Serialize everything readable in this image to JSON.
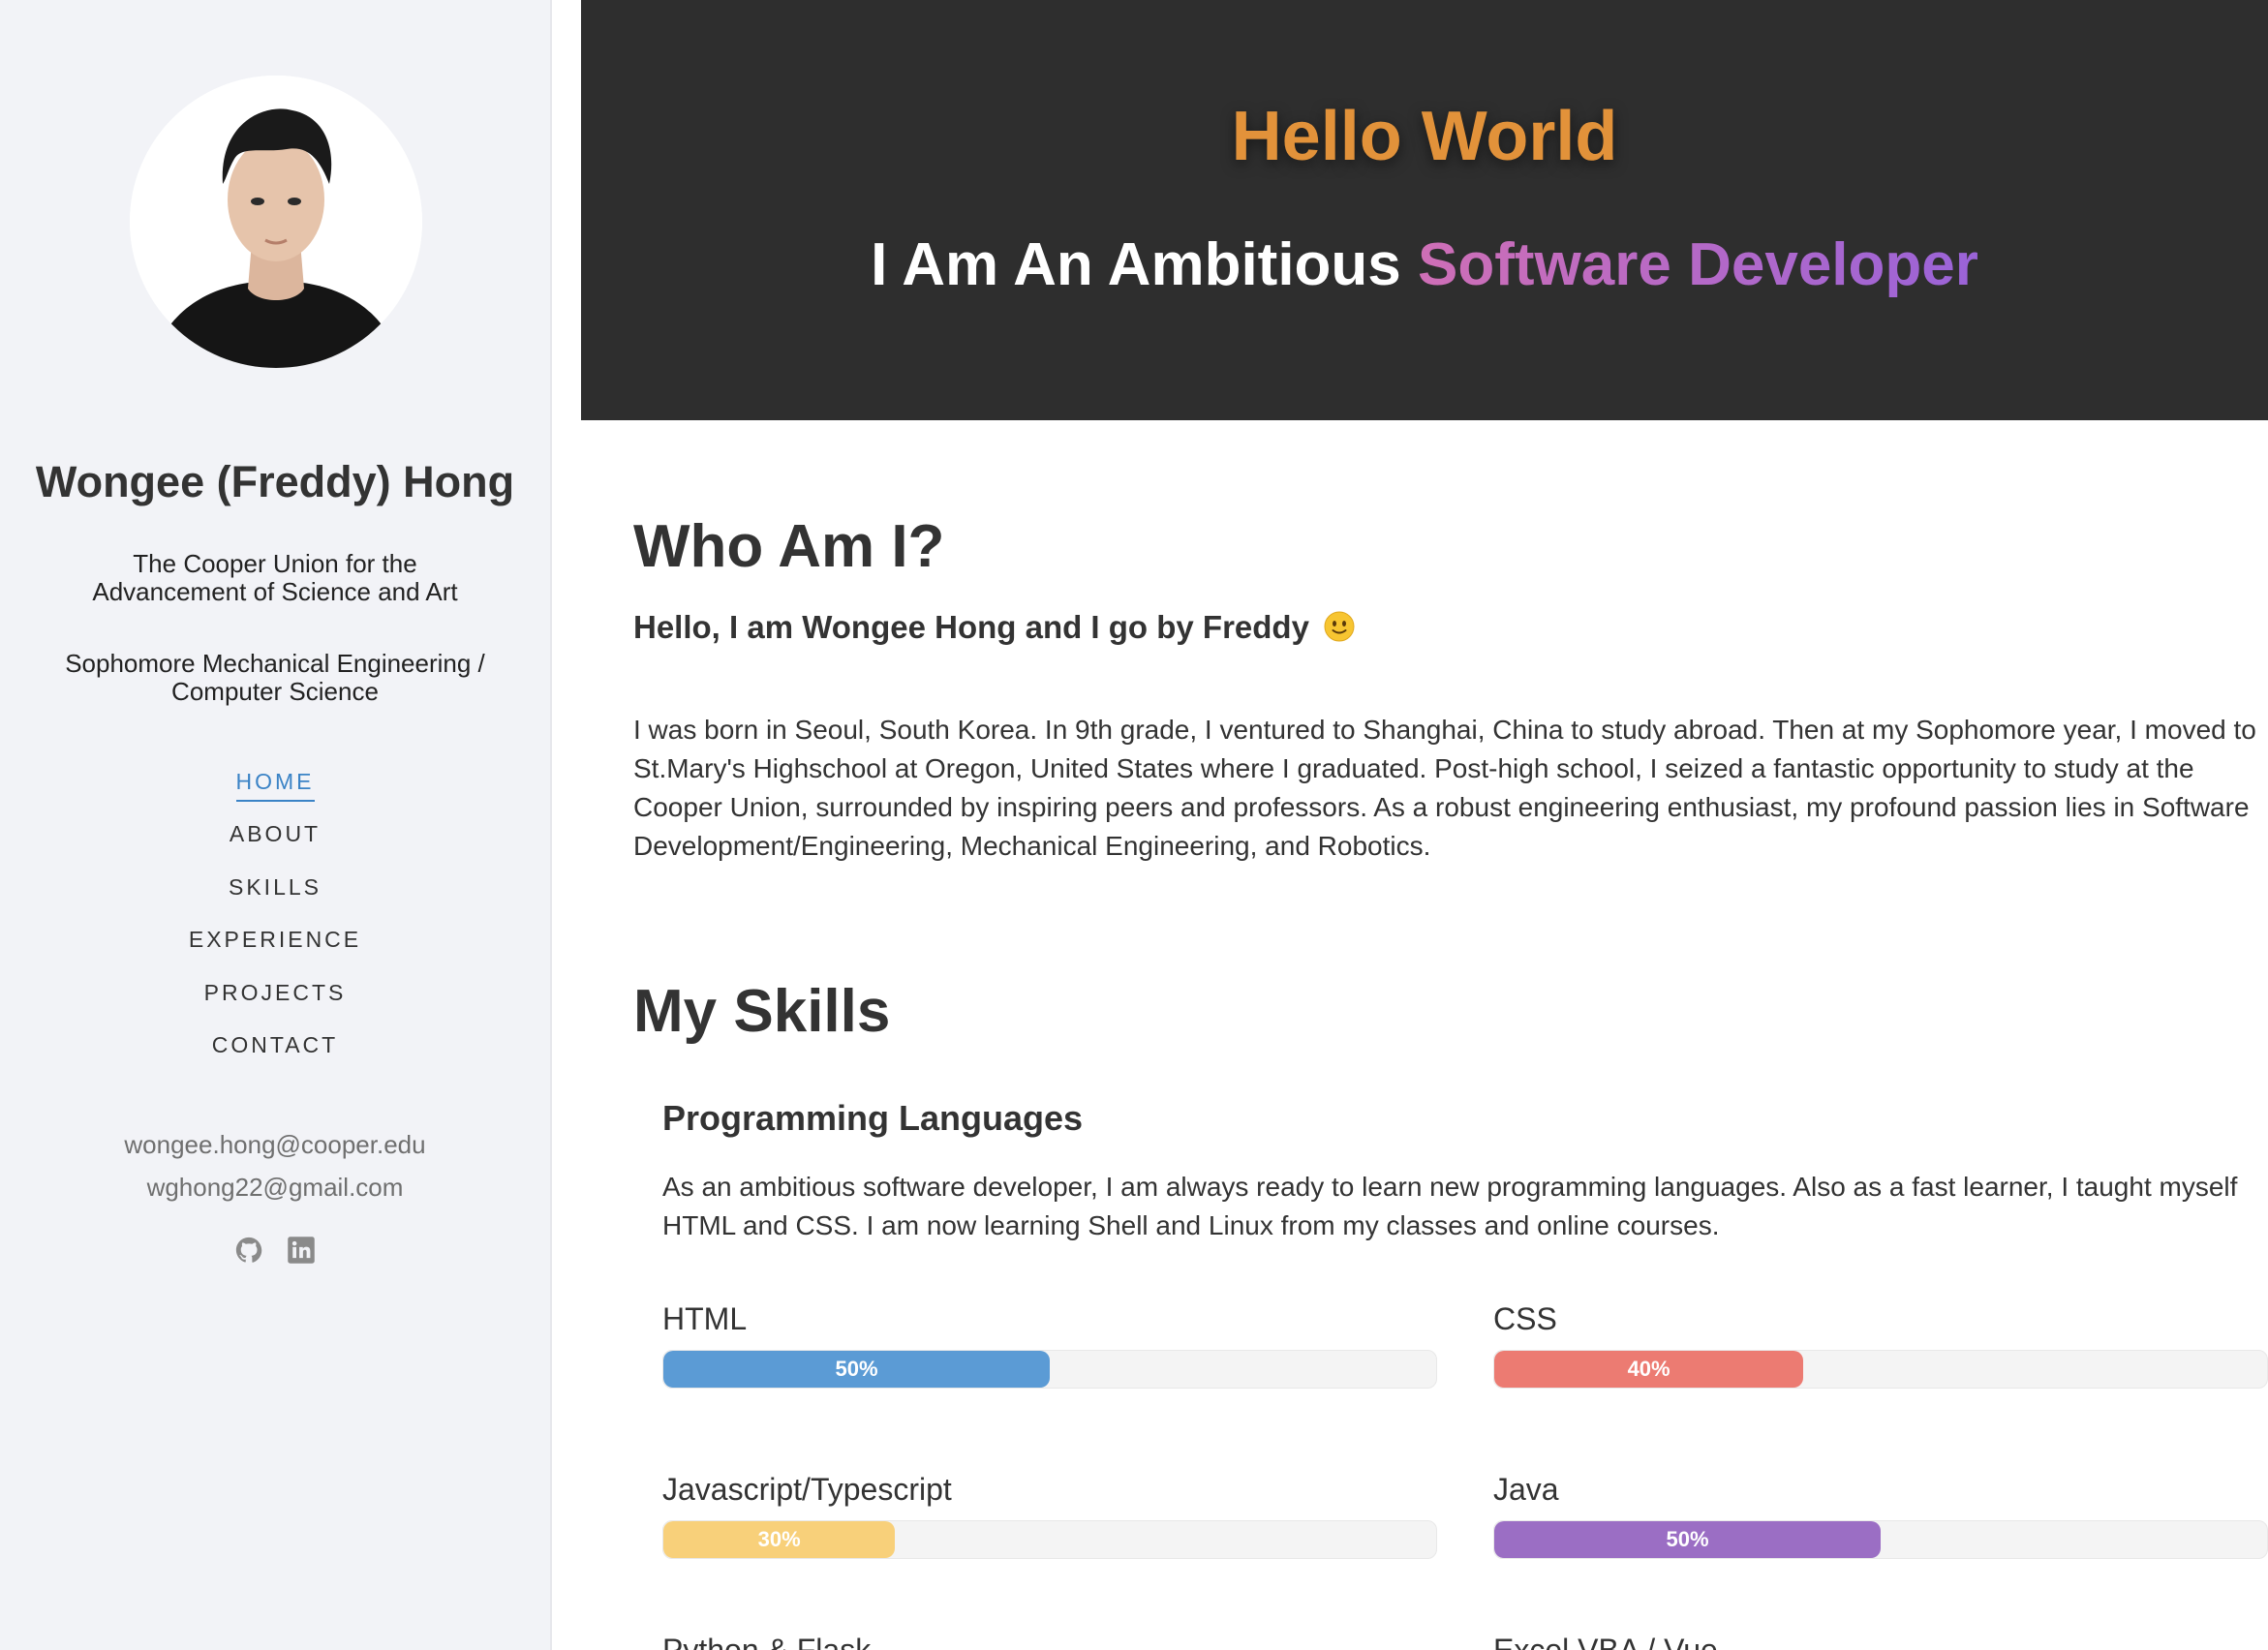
{
  "sidebar": {
    "name": "Wongee (Freddy) Hong",
    "school": "The Cooper Union for the Advancement of Science and Art",
    "major": "Sophomore Mechanical Engineering / Computer Science",
    "nav": [
      "HOME",
      "ABOUT",
      "SKILLS",
      "EXPERIENCE",
      "PROJECTS",
      "CONTACT"
    ],
    "emails": [
      "wongee.hong@cooper.edu",
      "wghong22@gmail.com"
    ],
    "socials": [
      "github-icon",
      "linkedin-icon"
    ]
  },
  "hero": {
    "title": "Hello World",
    "tagline_lead": "I Am An Ambitious",
    "tagline_highlight": "Software Developer",
    "title_color": "#e2923a"
  },
  "about": {
    "title": "Who Am I?",
    "subtitle": "Hello, I am Wongee Hong and I go by Freddy",
    "bio": "I was born in Seoul, South Korea. In 9th grade, I ventured to Shanghai, China to study abroad. Then at my Sophomore year, I moved to St.Mary's Highschool at Oregon, United States where I graduated. Post-high school, I seized a fantastic opportunity to study at the Cooper Union, surrounded by inspiring peers and professors. As a robust engineering enthusiast, my profound passion lies in Software Development/Engineering, Mechanical Engineering, and Robotics."
  },
  "skills": {
    "title": "My Skills",
    "programming": {
      "title": "Programming Languages",
      "description": "As an ambitious software developer, I am always ready to learn new programming languages. Also as a fast learner, I taught myself HTML and CSS. I am now learning Shell and Linux from my classes and online courses.",
      "items": [
        {
          "name": "HTML",
          "percent": 50,
          "label": "50%",
          "color": "#5b9bd5"
        },
        {
          "name": "CSS",
          "percent": 40,
          "label": "40%",
          "color": "#ec7b72"
        },
        {
          "name": "Javascript/Typescript",
          "percent": 30,
          "label": "30%",
          "color": "#f8d07a"
        },
        {
          "name": "Java",
          "percent": 50,
          "label": "50%",
          "color": "#9b6ec4"
        },
        {
          "name": "Python & Flask",
          "percent": 0,
          "label": "",
          "color": "#5b9bd5"
        },
        {
          "name": "Excel VBA / Vue",
          "percent": 0,
          "label": "",
          "color": "#ec7b72"
        }
      ]
    }
  }
}
